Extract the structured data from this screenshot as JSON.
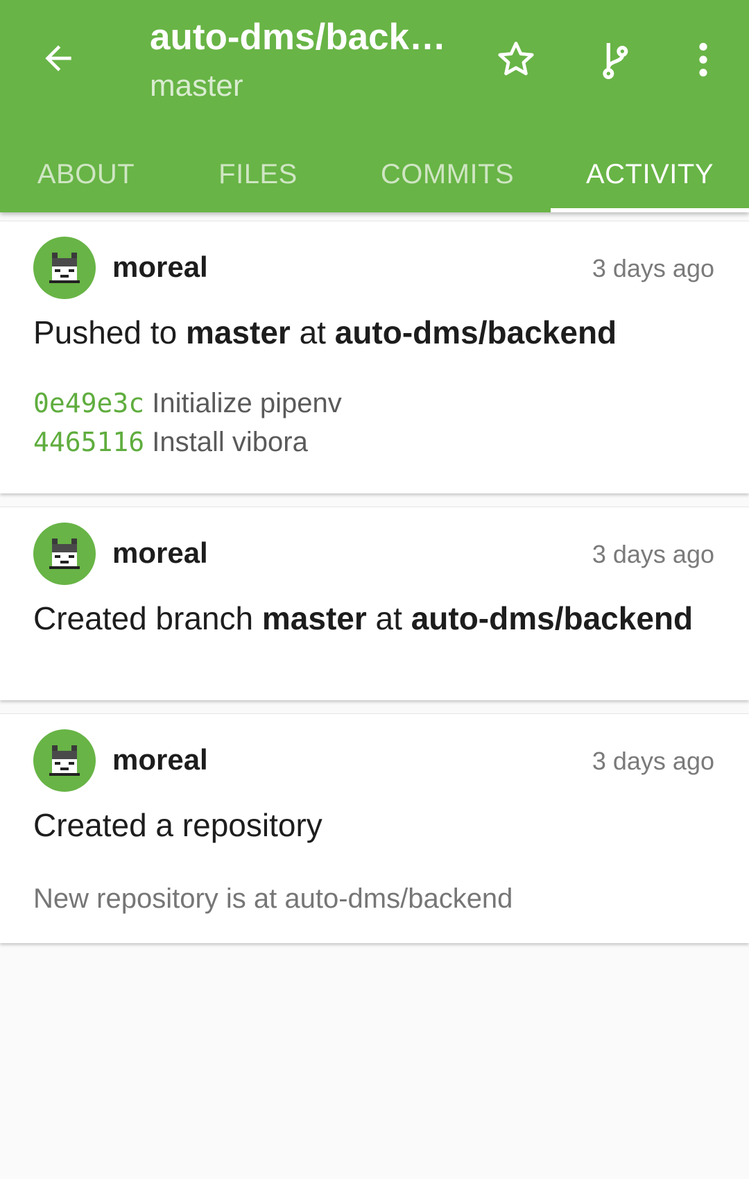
{
  "app_bar": {
    "title": "auto-dms/backend",
    "subtitle": "master",
    "icons": {
      "back": "arrow-back-icon",
      "star": "star-outline-icon",
      "branch": "git-branch-icon",
      "more": "more-vert-icon"
    },
    "tabs": [
      {
        "label": "ABOUT",
        "active": false
      },
      {
        "label": "FILES",
        "active": false
      },
      {
        "label": "COMMITS",
        "active": false
      },
      {
        "label": "ACTIVITY",
        "active": true
      }
    ]
  },
  "colors": {
    "primary": "#68b446",
    "sha": "#5fad3e",
    "background": "#fafafa"
  },
  "feed": [
    {
      "user": "moreal",
      "time": "3 days ago",
      "event": {
        "prefix": "Pushed to ",
        "ref": "master",
        "middle": " at ",
        "repo": "auto-dms/backend"
      },
      "commits": [
        {
          "sha": "0e49e3c",
          "message": "Initialize pipenv"
        },
        {
          "sha": "4465116",
          "message": "Install vibora"
        }
      ]
    },
    {
      "user": "moreal",
      "time": "3 days ago",
      "event": {
        "prefix": "Created branch ",
        "ref": "master",
        "middle": " at ",
        "repo": "auto-dms/backend"
      }
    },
    {
      "user": "moreal",
      "time": "3 days ago",
      "event": {
        "text": "Created a repository"
      },
      "description": "New repository is at auto-dms/backend"
    }
  ]
}
